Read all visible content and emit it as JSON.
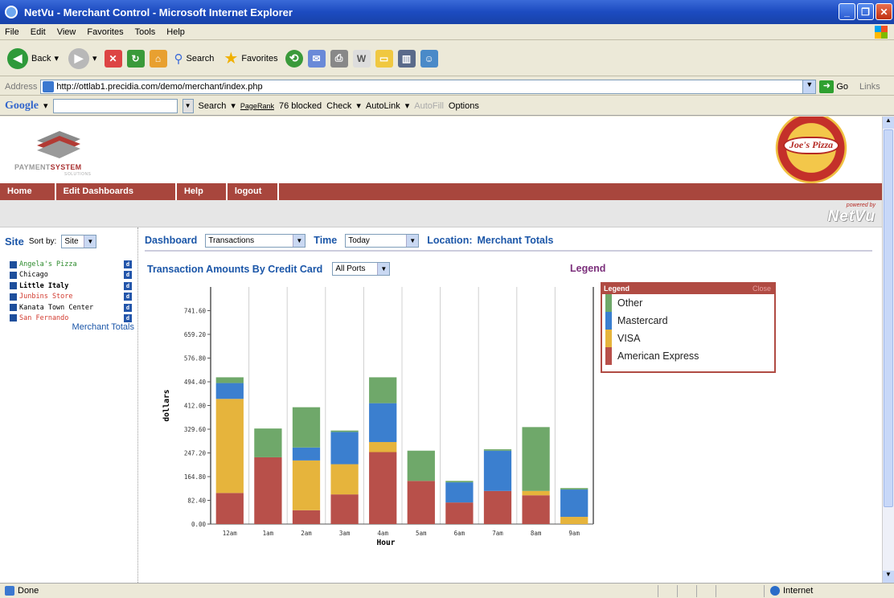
{
  "window": {
    "title": "NetVu - Merchant Control - Microsoft Internet Explorer"
  },
  "menu": [
    "File",
    "Edit",
    "View",
    "Favorites",
    "Tools",
    "Help"
  ],
  "toolbar": {
    "back": "Back",
    "search": "Search",
    "favorites": "Favorites"
  },
  "address": {
    "label": "Address",
    "url": "http://ottlab1.precidia.com/demo/merchant/index.php",
    "go": "Go",
    "links": "Links"
  },
  "googlebar": {
    "logo": "Google",
    "search": "Search",
    "pagerank": "PageRank",
    "blocked": "76 blocked",
    "check": "Check",
    "autolink": "AutoLink",
    "autofill": "AutoFill",
    "options": "Options"
  },
  "header": {
    "brand_a": "PAYMENT",
    "brand_b": "SYSTEM",
    "brand_sub": "SOLUTIONS",
    "merchant_logo": "Joe's Pizza",
    "powered_by": "powered by",
    "netvu": "NetVu"
  },
  "nav": [
    "Home",
    "Edit Dashboards",
    "Help",
    "logout"
  ],
  "sidebar": {
    "title": "Site",
    "sort_label": "Sort by:",
    "sort_value": "Site",
    "sites": [
      {
        "name": "Angela's Pizza",
        "style": "green"
      },
      {
        "name": "Chicago",
        "style": "black"
      },
      {
        "name": "Little Italy",
        "style": "black bold"
      },
      {
        "name": "Junbins Store",
        "style": "red"
      },
      {
        "name": "Kanata Town Center",
        "style": "black"
      },
      {
        "name": "San Fernando",
        "style": "red"
      }
    ],
    "d_label": "d",
    "merchant_totals": "Merchant Totals"
  },
  "dashboard": {
    "label": "Dashboard",
    "value": "Transactions",
    "time_label": "Time",
    "time_value": "Today",
    "location_label": "Location:",
    "location_value": "Merchant Totals"
  },
  "chart_header": {
    "title": "Transaction Amounts By Credit Card",
    "ports": "All Ports",
    "legend_link": "Legend"
  },
  "legend": {
    "title": "Legend",
    "close": "Close"
  },
  "colors": {
    "Other": "#6fa86a",
    "Mastercard": "#3b7fcf",
    "VISA": "#e6b43c",
    "American Express": "#b8504a"
  },
  "chart_data": {
    "type": "bar",
    "stacked": true,
    "xlabel": "Hour",
    "ylabel": "dollars",
    "categories": [
      "12am",
      "1am",
      "2am",
      "3am",
      "4am",
      "5am",
      "6am",
      "7am",
      "8am",
      "9am"
    ],
    "yticks": [
      "0.00",
      "82.40",
      "164.80",
      "247.20",
      "329.60",
      "412.00",
      "494.40",
      "576.80",
      "659.20",
      "741.60"
    ],
    "ylim": [
      0,
      824
    ],
    "grid": true,
    "series": [
      {
        "name": "American Express",
        "values": [
          108,
          232,
          48,
          103,
          250,
          150,
          75,
          115,
          100,
          0
        ]
      },
      {
        "name": "VISA",
        "values": [
          327,
          0,
          173,
          105,
          35,
          0,
          0,
          0,
          15,
          25
        ]
      },
      {
        "name": "Mastercard",
        "values": [
          55,
          0,
          45,
          112,
          135,
          0,
          70,
          140,
          0,
          95
        ]
      },
      {
        "name": "Other",
        "values": [
          20,
          100,
          140,
          5,
          90,
          105,
          5,
          5,
          222,
          5
        ]
      }
    ]
  },
  "status": {
    "left": "Done",
    "zone": "Internet"
  }
}
